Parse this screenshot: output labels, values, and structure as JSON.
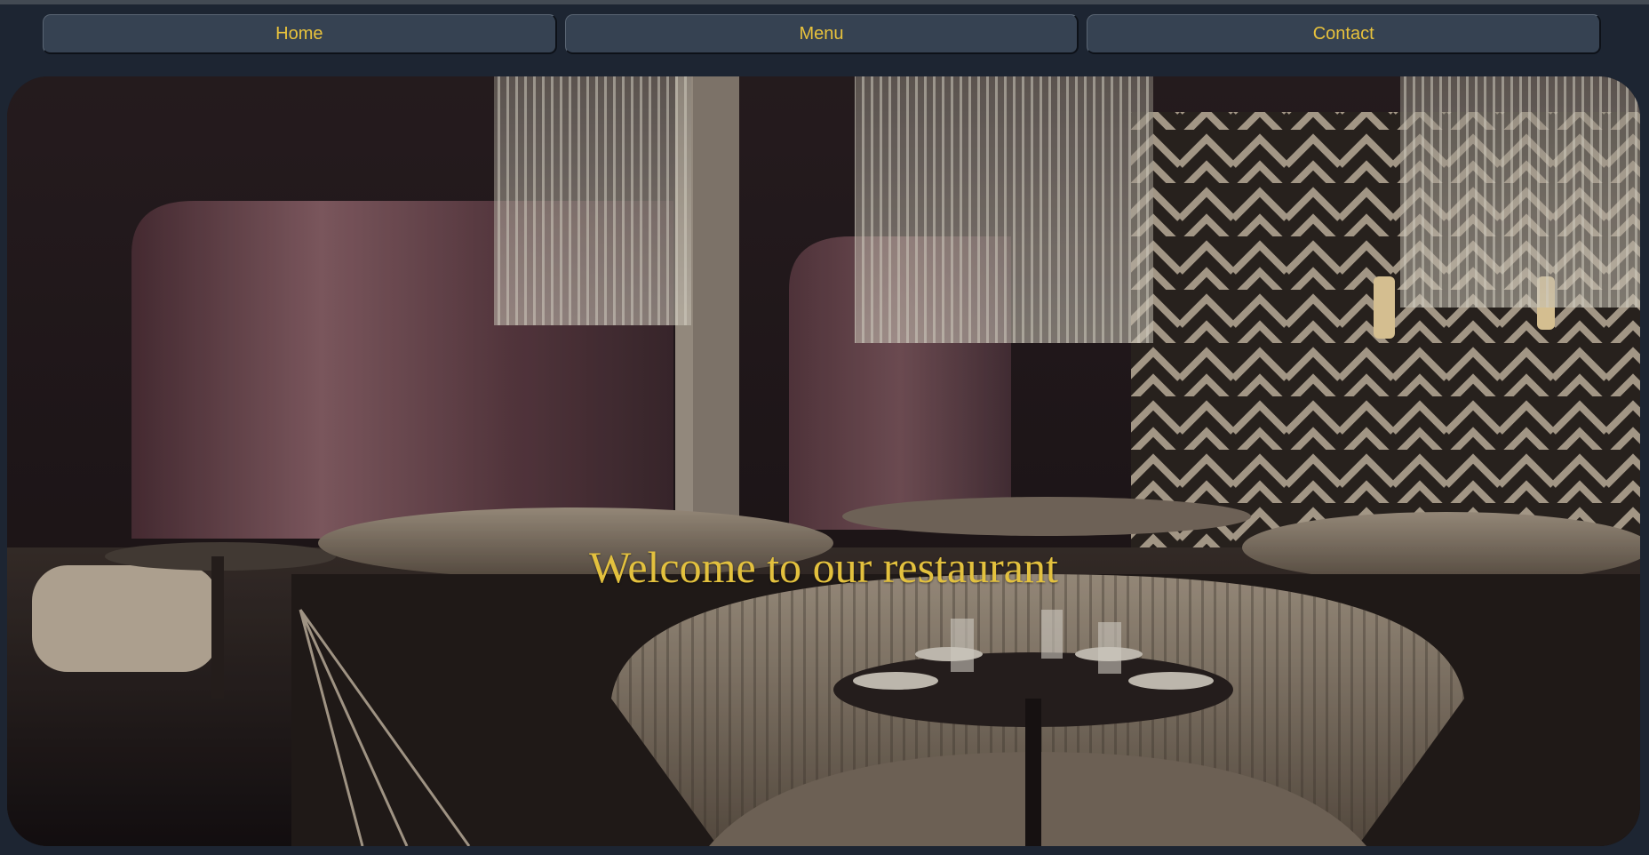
{
  "nav": {
    "items": [
      {
        "label": "Home"
      },
      {
        "label": "Menu"
      },
      {
        "label": "Contact"
      }
    ]
  },
  "hero": {
    "heading": "Welcome to our restaurant",
    "image_subject": "restaurant-interior-with-crystal-chandeliers-and-curved-booths"
  },
  "colors": {
    "background": "#1d2532",
    "nav_button": "#364252",
    "accent_text": "#e8c23c"
  }
}
